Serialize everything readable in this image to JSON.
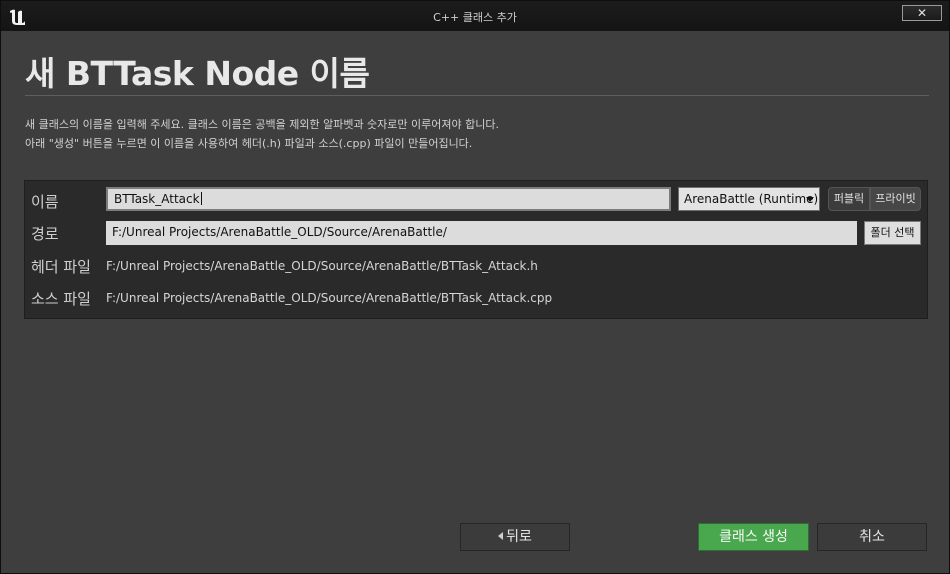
{
  "window": {
    "title": "C++ 클래스 추가",
    "close_glyph": "✕"
  },
  "page": {
    "heading": "새 BTTask Node 이름",
    "desc_line1": "새 클래스의 이름을 입력해 주세요. 클래스 이름은 공백을 제외한 알파벳과 숫자로만 이루어져야 합니다.",
    "desc_line2": "아래 \"생성\" 버튼을 누르면 이 이름을 사용하여 헤더(.h) 파일과 소스(.cpp) 파일이 만들어집니다."
  },
  "form": {
    "name_label": "이름",
    "name_value": "BTTask_Attack",
    "module_dropdown": "ArenaBattle (Runtime)",
    "public_label": "퍼블릭",
    "private_label": "프라이빗",
    "path_label": "경로",
    "path_value": "F:/Unreal Projects/ArenaBattle_OLD/Source/ArenaBattle/",
    "folder_button": "폴더 선택",
    "header_label": "헤더 파일",
    "header_value": "F:/Unreal Projects/ArenaBattle_OLD/Source/ArenaBattle/BTTask_Attack.h",
    "source_label": "소스 파일",
    "source_value": "F:/Unreal Projects/ArenaBattle_OLD/Source/ArenaBattle/BTTask_Attack.cpp"
  },
  "footer": {
    "back": "뒤로",
    "create": "클래스 생성",
    "cancel": "취소"
  },
  "colors": {
    "accent_green": "#49a84d",
    "background": "#3e3e3e",
    "panel": "#2a2a2a"
  },
  "icons": {
    "logo": "unreal-logo-icon",
    "back": "chevron-left-icon",
    "dropdown": "caret-down-icon"
  }
}
